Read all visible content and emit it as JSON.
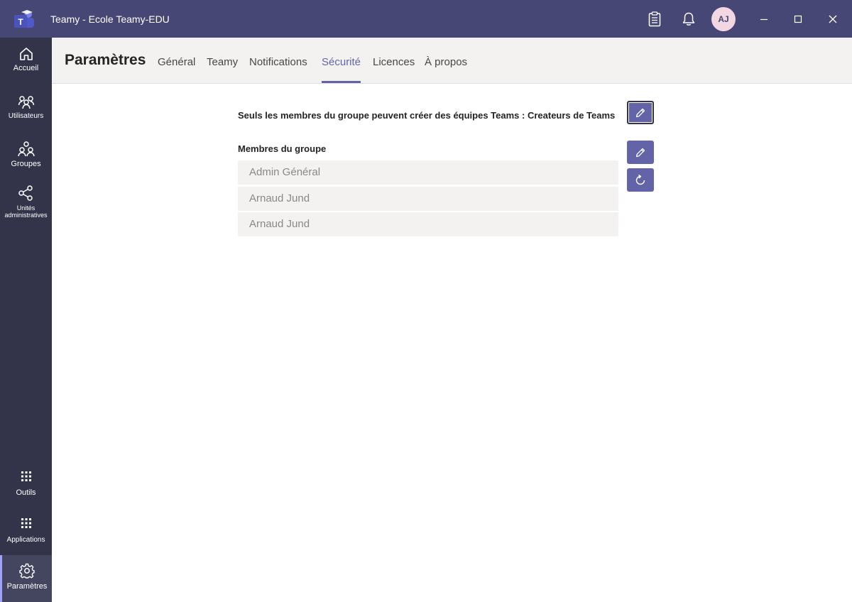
{
  "window": {
    "title": "Teamy - Ecole Teamy-EDU",
    "user_initials": "AJ",
    "accent": "#464775"
  },
  "rail": {
    "items": [
      {
        "label": "Accueil",
        "icon": "home-icon"
      },
      {
        "label": "Utilisateurs",
        "icon": "users-icon"
      },
      {
        "label": "Groupes",
        "icon": "groups-icon"
      },
      {
        "label": "Unités administratives",
        "icon": "admin-units-icon"
      },
      {
        "label": "Outils",
        "icon": "grid-icon"
      },
      {
        "label": "Applications",
        "icon": "grid-icon"
      },
      {
        "label": "Paramètres",
        "icon": "gear-icon",
        "active": true
      }
    ]
  },
  "header": {
    "title": "Paramètres",
    "tabs": [
      {
        "label": "Général"
      },
      {
        "label": "Teamy"
      },
      {
        "label": "Notifications"
      },
      {
        "label": "Sécurité",
        "active": true
      },
      {
        "label": "Licences"
      },
      {
        "label": "À propos"
      }
    ]
  },
  "security": {
    "creation_rule": "Seuls les membres du groupe peuvent créer des équipes Teams : Createurs de Teams",
    "members_label": "Membres du groupe",
    "members": [
      "Admin Général",
      "Arnaud Jund",
      "Arnaud Jund"
    ]
  }
}
